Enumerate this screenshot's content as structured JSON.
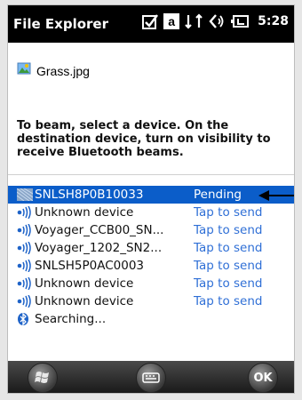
{
  "titlebar": {
    "title": "File Explorer",
    "time": "5:28",
    "icons": [
      "checkbox-icon",
      "a-box-icon",
      "network-icon",
      "volume-icon",
      "battery-icon"
    ]
  },
  "file": {
    "name": "Grass.jpg",
    "icon": "image-file-icon"
  },
  "instruction": "To beam, select a device. On the destination device, turn on visibility to receive Bluetooth beams.",
  "devices": [
    {
      "name": "SNLSH8P0B10033",
      "status": "Pending",
      "icon": "device-icon",
      "selected": true
    },
    {
      "name": "Unknown device",
      "status": "Tap to send",
      "icon": "beam-icon"
    },
    {
      "name": "Voyager_CCB00_SN...",
      "status": "Tap to send",
      "icon": "beam-icon"
    },
    {
      "name": "Voyager_1202_SN2...",
      "status": "Tap to send",
      "icon": "beam-icon"
    },
    {
      "name": "SNLSH5P0AC0003",
      "status": "Tap to send",
      "icon": "beam-icon"
    },
    {
      "name": "Unknown device",
      "status": "Tap to send",
      "icon": "beam-icon"
    },
    {
      "name": "Unknown device",
      "status": "Tap to send",
      "icon": "beam-icon"
    },
    {
      "name": "Searching...",
      "status": "",
      "icon": "bluetooth-icon"
    }
  ],
  "softkeys": {
    "ok_label": "OK",
    "left": "windows-start-icon",
    "middle": "keyboard-icon"
  },
  "colors": {
    "selection": "#0b5dc9",
    "status_text": "#2f6fd6",
    "titlebar": "#000000"
  }
}
